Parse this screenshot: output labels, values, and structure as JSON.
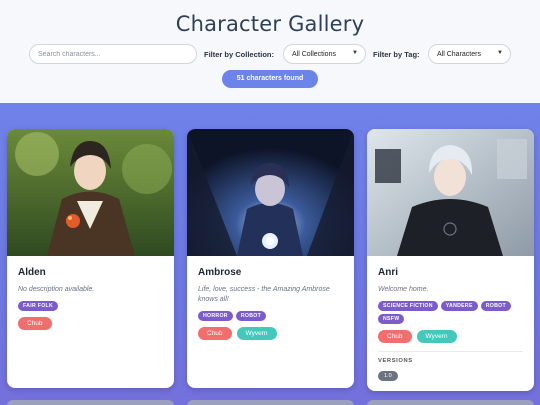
{
  "header": {
    "title": "Character Gallery",
    "search_placeholder": "Search characters...",
    "collection_label": "Filter by Collection:",
    "collection_value": "All Collections",
    "tag_label": "Filter by Tag:",
    "tag_value": "All Characters",
    "count_text": "51 characters found"
  },
  "cards": [
    {
      "name": "Alden",
      "description": "No description available.",
      "tags": [
        "FAIR FOLK"
      ],
      "sources": [
        "Chub"
      ]
    },
    {
      "name": "Ambrose",
      "description": "Life, love, success - the Amazing Ambrose knows all!",
      "tags": [
        "HORROR",
        "ROBOT"
      ],
      "sources": [
        "Chub",
        "Wyvern"
      ]
    },
    {
      "name": "Anri",
      "description": "Welcome home.",
      "tags": [
        "SCIENCE FICTION",
        "YANDERE",
        "ROBOT",
        "NSFW"
      ],
      "sources": [
        "Chub",
        "Wyvern"
      ],
      "versions_label": "VERSIONS",
      "versions": [
        "1.0"
      ]
    }
  ],
  "colors": {
    "accent": "#6c83ea",
    "tag": "#7b5cc8",
    "chub": "#f26d6d",
    "wyvern": "#43c9bb",
    "gallery_bg": "#6f82e9"
  }
}
